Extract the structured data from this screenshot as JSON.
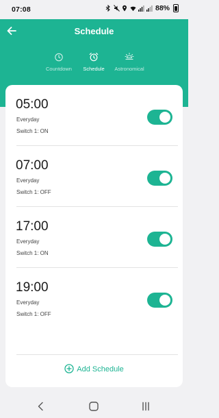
{
  "status_bar": {
    "time": "07:08",
    "battery": "88%",
    "icons": [
      "bluetooth-icon",
      "mute-icon",
      "location-icon",
      "wifi-icon",
      "signal-icon",
      "signal-icon",
      "battery-icon"
    ]
  },
  "header": {
    "title": "Schedule",
    "back_icon": "arrow-left-icon"
  },
  "tabs": [
    {
      "label": "Countdown",
      "icon": "timer-icon",
      "active": false
    },
    {
      "label": "Schedule",
      "icon": "alarm-clock-icon",
      "active": true
    },
    {
      "label": "Astronomical",
      "icon": "sun-icon",
      "active": false
    }
  ],
  "schedules": [
    {
      "time": "05:00",
      "repeat": "Everyday",
      "action": "Switch 1: ON",
      "enabled": true
    },
    {
      "time": "07:00",
      "repeat": "Everyday",
      "action": "Switch 1: OFF",
      "enabled": true
    },
    {
      "time": "17:00",
      "repeat": "Everyday",
      "action": "Switch 1: ON",
      "enabled": true
    },
    {
      "time": "19:00",
      "repeat": "Everyday",
      "action": "Switch 1: OFF",
      "enabled": true
    }
  ],
  "add_schedule": {
    "label": "Add Schedule"
  },
  "colors": {
    "accent": "#1db493",
    "background": "#f1f1f3",
    "card": "#ffffff",
    "text": "#1a1a1a"
  }
}
